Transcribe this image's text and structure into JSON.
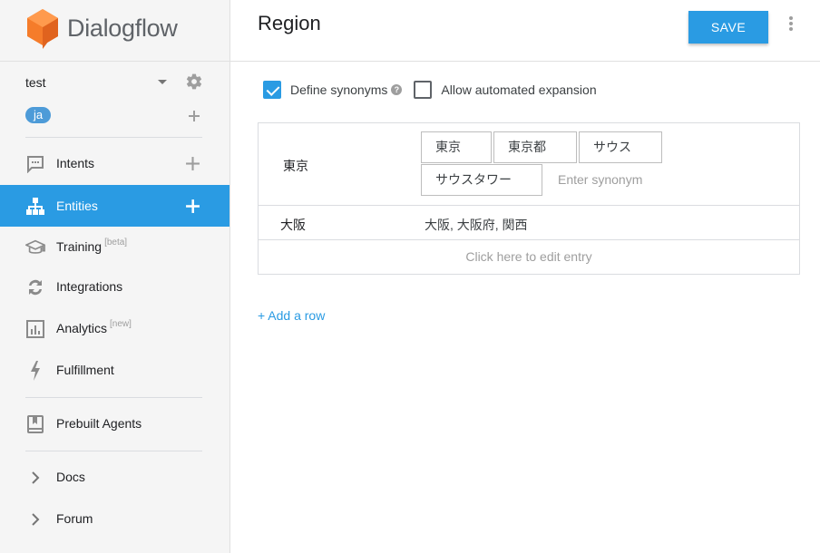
{
  "brand": {
    "name": "Dialogflow",
    "color": "#f57c2a"
  },
  "agent": {
    "name": "test",
    "language": "ja",
    "caret_icon": "caret-down-icon",
    "settings_icon": "gear-icon"
  },
  "nav": {
    "items": [
      {
        "label": "Intents",
        "icon": "intents-chat-icon",
        "has_add": true,
        "active": false
      },
      {
        "label": "Entities",
        "icon": "entities-hierarchy-icon",
        "has_add": true,
        "active": true
      },
      {
        "label": "Training",
        "sup": "[beta]",
        "icon": "training-graduation-cap-icon"
      },
      {
        "label": "Integrations",
        "icon": "integrations-sync-icon"
      },
      {
        "label": "Analytics",
        "sup": "[new]",
        "icon": "analytics-bar-chart-icon"
      },
      {
        "label": "Fulfillment",
        "icon": "fulfillment-bolt-icon"
      },
      {
        "label": "Prebuilt Agents",
        "icon": "prebuilt-agents-book-icon"
      },
      {
        "label": "Docs",
        "icon": "chevron-right-icon"
      },
      {
        "label": "Forum",
        "icon": "chevron-right-icon"
      }
    ]
  },
  "header": {
    "title": "Region",
    "save_label": "SAVE"
  },
  "options": {
    "define_synonyms": {
      "label": "Define synonyms",
      "checked": true
    },
    "allow_expansion": {
      "label": "Allow automated expansion",
      "checked": false
    }
  },
  "entries": [
    {
      "value": "東京",
      "synonyms": [
        "東京",
        "東京都",
        "サウス",
        "サウスタワー"
      ],
      "input_placeholder": "Enter synonym"
    },
    {
      "value": "大阪",
      "synonyms_text": "大阪, 大阪府, 関西"
    }
  ],
  "edit_entry_label": "Click here to edit entry",
  "add_row_label": "+ Add a row",
  "colors": {
    "accent": "#2a9be3",
    "sidebar_bg": "#f5f5f5"
  }
}
